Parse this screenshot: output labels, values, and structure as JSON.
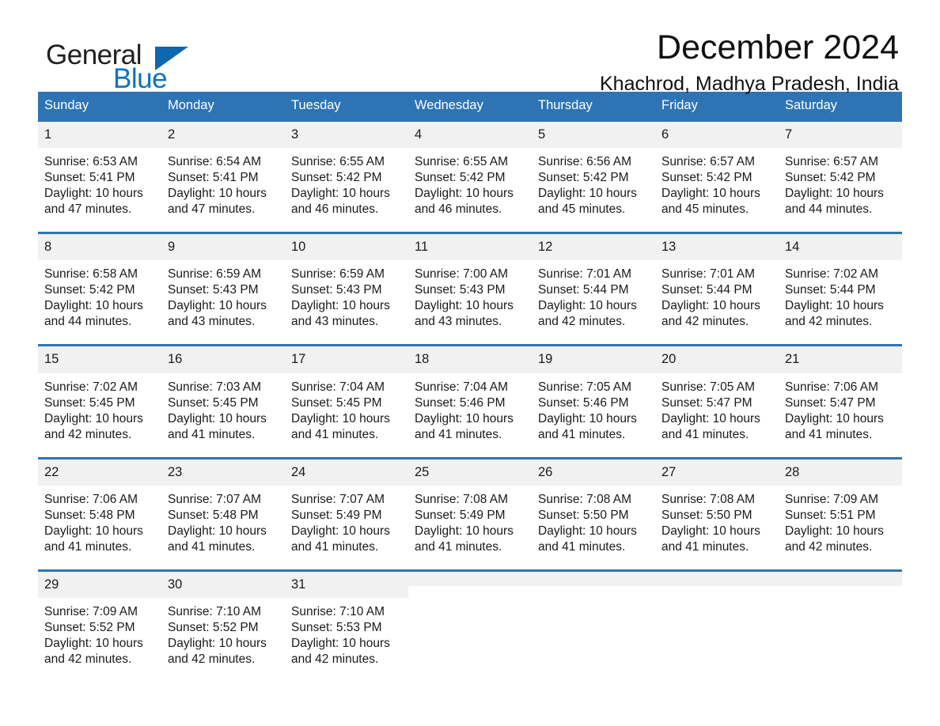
{
  "brand": {
    "word_general": "General",
    "word_blue": "Blue",
    "triangle_color": "#0c68b0",
    "blue_color": "#0f72bd"
  },
  "header": {
    "title": "December 2024",
    "subtitle": "Khachrod, Madhya Pradesh, India"
  },
  "theme": {
    "header_blue": "#2e74b5",
    "row_border_blue": "#2e74b5",
    "daynum_band": "#f1f1f1",
    "page_background": "#ffffff"
  },
  "calendar": {
    "weekday_headers": [
      "Sunday",
      "Monday",
      "Tuesday",
      "Wednesday",
      "Thursday",
      "Friday",
      "Saturday"
    ],
    "weeks": [
      [
        {
          "day": "1",
          "sunrise": "Sunrise: 6:53 AM",
          "sunset": "Sunset: 5:41 PM",
          "daylight": "Daylight: 10 hours and 47 minutes."
        },
        {
          "day": "2",
          "sunrise": "Sunrise: 6:54 AM",
          "sunset": "Sunset: 5:41 PM",
          "daylight": "Daylight: 10 hours and 47 minutes."
        },
        {
          "day": "3",
          "sunrise": "Sunrise: 6:55 AM",
          "sunset": "Sunset: 5:42 PM",
          "daylight": "Daylight: 10 hours and 46 minutes."
        },
        {
          "day": "4",
          "sunrise": "Sunrise: 6:55 AM",
          "sunset": "Sunset: 5:42 PM",
          "daylight": "Daylight: 10 hours and 46 minutes."
        },
        {
          "day": "5",
          "sunrise": "Sunrise: 6:56 AM",
          "sunset": "Sunset: 5:42 PM",
          "daylight": "Daylight: 10 hours and 45 minutes."
        },
        {
          "day": "6",
          "sunrise": "Sunrise: 6:57 AM",
          "sunset": "Sunset: 5:42 PM",
          "daylight": "Daylight: 10 hours and 45 minutes."
        },
        {
          "day": "7",
          "sunrise": "Sunrise: 6:57 AM",
          "sunset": "Sunset: 5:42 PM",
          "daylight": "Daylight: 10 hours and 44 minutes."
        }
      ],
      [
        {
          "day": "8",
          "sunrise": "Sunrise: 6:58 AM",
          "sunset": "Sunset: 5:42 PM",
          "daylight": "Daylight: 10 hours and 44 minutes."
        },
        {
          "day": "9",
          "sunrise": "Sunrise: 6:59 AM",
          "sunset": "Sunset: 5:43 PM",
          "daylight": "Daylight: 10 hours and 43 minutes."
        },
        {
          "day": "10",
          "sunrise": "Sunrise: 6:59 AM",
          "sunset": "Sunset: 5:43 PM",
          "daylight": "Daylight: 10 hours and 43 minutes."
        },
        {
          "day": "11",
          "sunrise": "Sunrise: 7:00 AM",
          "sunset": "Sunset: 5:43 PM",
          "daylight": "Daylight: 10 hours and 43 minutes."
        },
        {
          "day": "12",
          "sunrise": "Sunrise: 7:01 AM",
          "sunset": "Sunset: 5:44 PM",
          "daylight": "Daylight: 10 hours and 42 minutes."
        },
        {
          "day": "13",
          "sunrise": "Sunrise: 7:01 AM",
          "sunset": "Sunset: 5:44 PM",
          "daylight": "Daylight: 10 hours and 42 minutes."
        },
        {
          "day": "14",
          "sunrise": "Sunrise: 7:02 AM",
          "sunset": "Sunset: 5:44 PM",
          "daylight": "Daylight: 10 hours and 42 minutes."
        }
      ],
      [
        {
          "day": "15",
          "sunrise": "Sunrise: 7:02 AM",
          "sunset": "Sunset: 5:45 PM",
          "daylight": "Daylight: 10 hours and 42 minutes."
        },
        {
          "day": "16",
          "sunrise": "Sunrise: 7:03 AM",
          "sunset": "Sunset: 5:45 PM",
          "daylight": "Daylight: 10 hours and 41 minutes."
        },
        {
          "day": "17",
          "sunrise": "Sunrise: 7:04 AM",
          "sunset": "Sunset: 5:45 PM",
          "daylight": "Daylight: 10 hours and 41 minutes."
        },
        {
          "day": "18",
          "sunrise": "Sunrise: 7:04 AM",
          "sunset": "Sunset: 5:46 PM",
          "daylight": "Daylight: 10 hours and 41 minutes."
        },
        {
          "day": "19",
          "sunrise": "Sunrise: 7:05 AM",
          "sunset": "Sunset: 5:46 PM",
          "daylight": "Daylight: 10 hours and 41 minutes."
        },
        {
          "day": "20",
          "sunrise": "Sunrise: 7:05 AM",
          "sunset": "Sunset: 5:47 PM",
          "daylight": "Daylight: 10 hours and 41 minutes."
        },
        {
          "day": "21",
          "sunrise": "Sunrise: 7:06 AM",
          "sunset": "Sunset: 5:47 PM",
          "daylight": "Daylight: 10 hours and 41 minutes."
        }
      ],
      [
        {
          "day": "22",
          "sunrise": "Sunrise: 7:06 AM",
          "sunset": "Sunset: 5:48 PM",
          "daylight": "Daylight: 10 hours and 41 minutes."
        },
        {
          "day": "23",
          "sunrise": "Sunrise: 7:07 AM",
          "sunset": "Sunset: 5:48 PM",
          "daylight": "Daylight: 10 hours and 41 minutes."
        },
        {
          "day": "24",
          "sunrise": "Sunrise: 7:07 AM",
          "sunset": "Sunset: 5:49 PM",
          "daylight": "Daylight: 10 hours and 41 minutes."
        },
        {
          "day": "25",
          "sunrise": "Sunrise: 7:08 AM",
          "sunset": "Sunset: 5:49 PM",
          "daylight": "Daylight: 10 hours and 41 minutes."
        },
        {
          "day": "26",
          "sunrise": "Sunrise: 7:08 AM",
          "sunset": "Sunset: 5:50 PM",
          "daylight": "Daylight: 10 hours and 41 minutes."
        },
        {
          "day": "27",
          "sunrise": "Sunrise: 7:08 AM",
          "sunset": "Sunset: 5:50 PM",
          "daylight": "Daylight: 10 hours and 41 minutes."
        },
        {
          "day": "28",
          "sunrise": "Sunrise: 7:09 AM",
          "sunset": "Sunset: 5:51 PM",
          "daylight": "Daylight: 10 hours and 42 minutes."
        }
      ],
      [
        {
          "day": "29",
          "sunrise": "Sunrise: 7:09 AM",
          "sunset": "Sunset: 5:52 PM",
          "daylight": "Daylight: 10 hours and 42 minutes."
        },
        {
          "day": "30",
          "sunrise": "Sunrise: 7:10 AM",
          "sunset": "Sunset: 5:52 PM",
          "daylight": "Daylight: 10 hours and 42 minutes."
        },
        {
          "day": "31",
          "sunrise": "Sunrise: 7:10 AM",
          "sunset": "Sunset: 5:53 PM",
          "daylight": "Daylight: 10 hours and 42 minutes."
        },
        {
          "day": "",
          "sunrise": "",
          "sunset": "",
          "daylight": ""
        },
        {
          "day": "",
          "sunrise": "",
          "sunset": "",
          "daylight": ""
        },
        {
          "day": "",
          "sunrise": "",
          "sunset": "",
          "daylight": ""
        },
        {
          "day": "",
          "sunrise": "",
          "sunset": "",
          "daylight": ""
        }
      ]
    ]
  }
}
